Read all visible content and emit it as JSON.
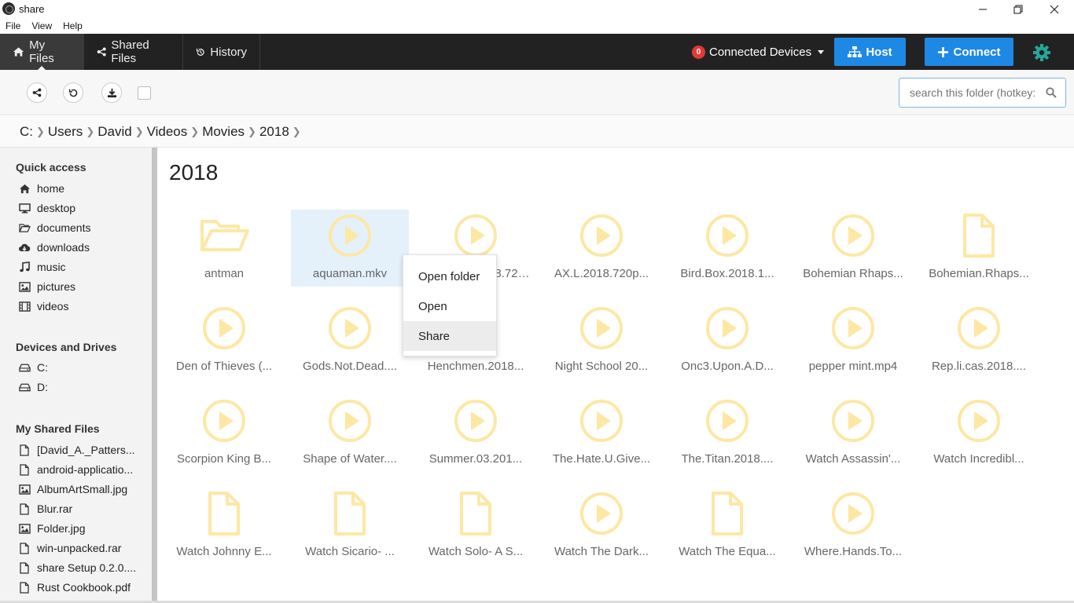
{
  "window": {
    "title": "share",
    "minimize": "—",
    "restore": "❐",
    "close": "✕"
  },
  "menu": [
    "File",
    "View",
    "Help"
  ],
  "nav": {
    "tabs": [
      {
        "label": "My Files",
        "icon": "home-icon",
        "active": true
      },
      {
        "label": "Shared Files",
        "icon": "share-icon"
      },
      {
        "label": "History",
        "icon": "history-icon"
      }
    ],
    "devices_count": "0",
    "devices_label": "Connected Devices",
    "host_label": "Host",
    "connect_label": "Connect"
  },
  "toolbar": {
    "search_placeholder": "search this folder (hotkey: /)"
  },
  "breadcrumb": [
    "C:",
    "Users",
    "David",
    "Videos",
    "Movies",
    "2018"
  ],
  "sidebar": {
    "quick_access_title": "Quick access",
    "quick_access": [
      {
        "label": "home",
        "icon": "home-icon"
      },
      {
        "label": "desktop",
        "icon": "desktop-icon"
      },
      {
        "label": "documents",
        "icon": "folder-open-icon"
      },
      {
        "label": "downloads",
        "icon": "cloud-download-icon"
      },
      {
        "label": "music",
        "icon": "music-icon"
      },
      {
        "label": "pictures",
        "icon": "image-icon"
      },
      {
        "label": "videos",
        "icon": "film-icon"
      }
    ],
    "drives_title": "Devices and Drives",
    "drives": [
      {
        "label": "C:",
        "icon": "drive-icon"
      },
      {
        "label": "D:",
        "icon": "drive-icon"
      }
    ],
    "shared_title": "My Shared Files",
    "shared": [
      {
        "label": "[David_A._Patters...",
        "icon": "file-icon"
      },
      {
        "label": "android-applicatio...",
        "icon": "file-icon"
      },
      {
        "label": "AlbumArtSmall.jpg",
        "icon": "image-icon"
      },
      {
        "label": "Blur.rar",
        "icon": "file-icon"
      },
      {
        "label": "Folder.jpg",
        "icon": "image-icon"
      },
      {
        "label": "win-unpacked.rar",
        "icon": "file-icon"
      },
      {
        "label": "share Setup 0.2.0....",
        "icon": "file-icon"
      },
      {
        "label": "Rust Cookbook.pdf",
        "icon": "file-icon"
      }
    ]
  },
  "main": {
    "title": "2018",
    "files": [
      {
        "name": "antman",
        "type": "folder"
      },
      {
        "name": "aquaman.mkv",
        "type": "video",
        "selected": true
      },
      {
        "name": "Aquaman.2018.720...",
        "type": "video"
      },
      {
        "name": "AX.L.2018.720p...",
        "type": "video"
      },
      {
        "name": "Bird.Box.2018.1...",
        "type": "video"
      },
      {
        "name": "Bohemian Rhaps...",
        "type": "video"
      },
      {
        "name": "Bohemian.Rhaps...",
        "type": "file"
      },
      {
        "name": "Den of Thieves (...",
        "type": "video"
      },
      {
        "name": "Gods.Not.Dead....",
        "type": "video"
      },
      {
        "name": "Henchmen.2018...",
        "type": "video"
      },
      {
        "name": "Night School 20...",
        "type": "video"
      },
      {
        "name": "Onc3.Upon.A.D...",
        "type": "video"
      },
      {
        "name": "pepper mint.mp4",
        "type": "video"
      },
      {
        "name": "Rep.li.cas.2018....",
        "type": "video"
      },
      {
        "name": "Scorpion King B...",
        "type": "video"
      },
      {
        "name": "Shape of Water....",
        "type": "video"
      },
      {
        "name": "Summer.03.201...",
        "type": "video"
      },
      {
        "name": "The.Hate.U.Give...",
        "type": "video"
      },
      {
        "name": "The.Titan.2018....",
        "type": "video"
      },
      {
        "name": "Watch Assassin'...",
        "type": "video"
      },
      {
        "name": "Watch Incredibl...",
        "type": "video"
      },
      {
        "name": "Watch Johnny E...",
        "type": "file"
      },
      {
        "name": "Watch Sicario- ...",
        "type": "file"
      },
      {
        "name": "Watch Solo- A S...",
        "type": "file"
      },
      {
        "name": "Watch The Dark...",
        "type": "video"
      },
      {
        "name": "Watch The Equa...",
        "type": "file"
      },
      {
        "name": "Where.Hands.To...",
        "type": "video"
      }
    ]
  },
  "context_menu": [
    {
      "label": "Open folder"
    },
    {
      "label": "Open"
    },
    {
      "label": "Share",
      "hover": true
    }
  ],
  "colors": {
    "nav_bg": "#222222",
    "accent_blue": "#1e88e5",
    "gear": "#26a69a",
    "file_icon": "#fde7a3",
    "badge": "#e53935",
    "selected_tile": "#e4f1fb"
  }
}
